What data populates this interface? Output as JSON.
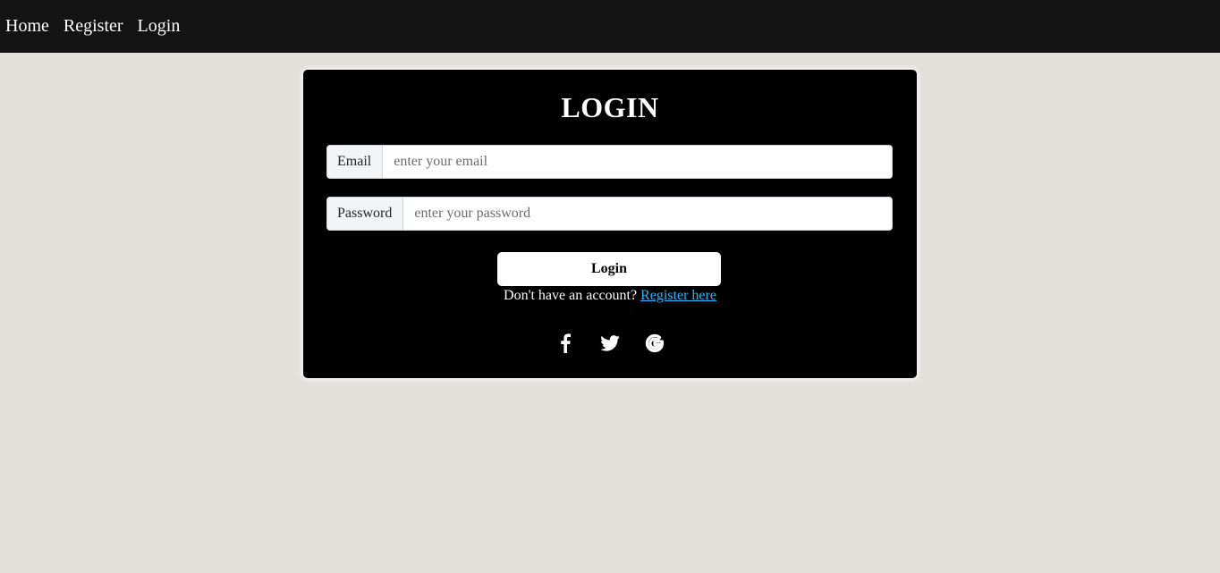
{
  "nav": {
    "items": [
      {
        "label": "Home"
      },
      {
        "label": "Register"
      },
      {
        "label": "Login"
      }
    ]
  },
  "form": {
    "title": "LOGIN",
    "email": {
      "label": "Email",
      "placeholder": "enter your email",
      "value": ""
    },
    "password": {
      "label": "Password",
      "placeholder": "enter your password",
      "value": ""
    },
    "submit_label": "Login",
    "register_prompt": "Don't have an account?",
    "register_link": "Register here"
  },
  "socials": [
    {
      "icon": "facebook-icon"
    },
    {
      "icon": "twitter-icon"
    },
    {
      "icon": "google-icon"
    }
  ],
  "colors": {
    "navbar": "#131313",
    "page_background": "#e3e0db",
    "card": "#000000",
    "link": "#29b6f6"
  }
}
